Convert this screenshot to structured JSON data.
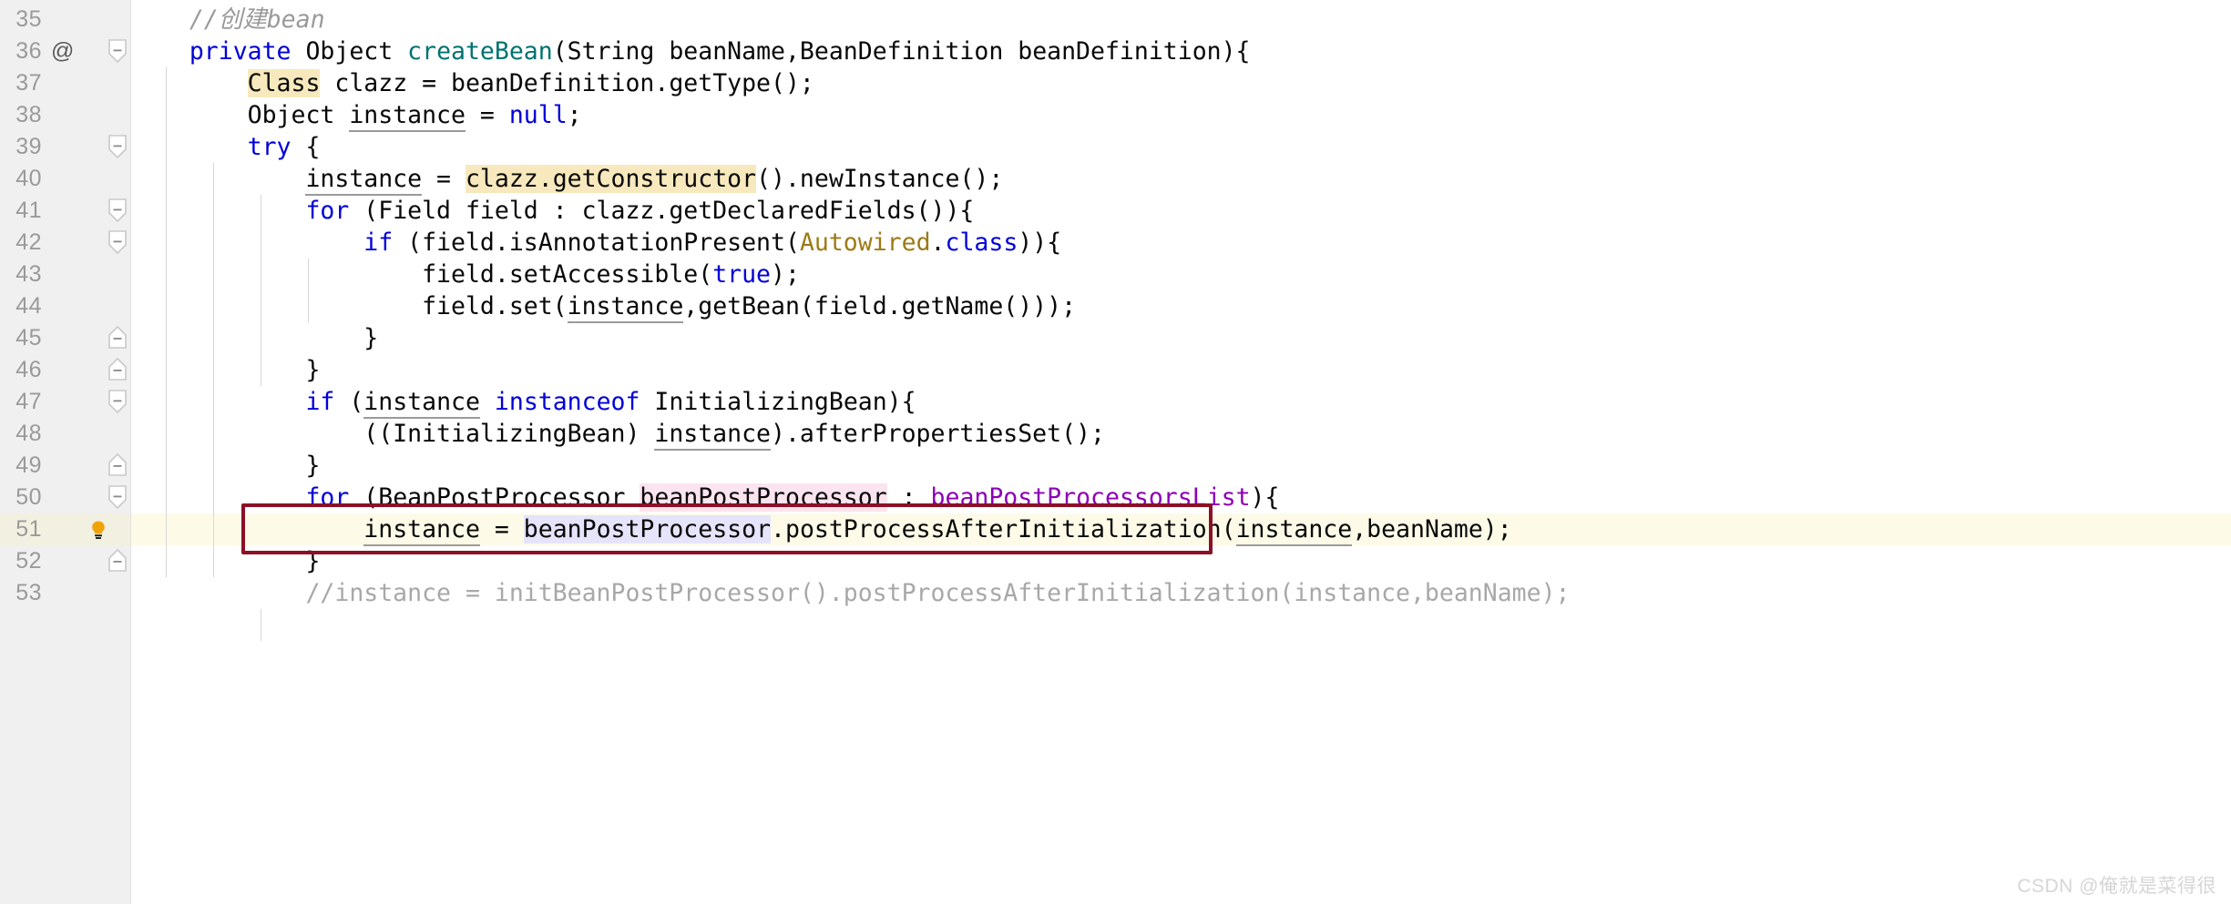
{
  "editor": {
    "first_line": 35,
    "last_line": 53,
    "current_line": 51,
    "gutter_annotation_line": 36,
    "gutter_annotation_symbol": "@",
    "bulb_line": 51,
    "colors": {
      "background": "#ffffff",
      "gutter": "#f0f0f0",
      "line_number": "#9a9a9a",
      "keyword": "#0000d8",
      "method": "#00736f",
      "annotation": "#9c7a15",
      "static_field": "#8d00b5",
      "comment": "#9a9a9a",
      "highlight_yellow": "#f7e9bd",
      "highlight_pink": "#fbe4ef",
      "highlight_violet": "#e6e4fa",
      "current_line_background": "#fdfbe8",
      "error_box_border": "#8c1026"
    }
  },
  "lines": [
    {
      "num": "35",
      "text": "    //创建bean"
    },
    {
      "num": "36",
      "text": "    private Object createBean(String beanName,BeanDefinition beanDefinition){"
    },
    {
      "num": "37",
      "text": "        Class clazz = beanDefinition.getType();"
    },
    {
      "num": "38",
      "text": "        Object instance = null;"
    },
    {
      "num": "39",
      "text": "        try {"
    },
    {
      "num": "40",
      "text": "            instance = clazz.getConstructor().newInstance();"
    },
    {
      "num": "41",
      "text": "            for (Field field : clazz.getDeclaredFields()){"
    },
    {
      "num": "42",
      "text": "                if (field.isAnnotationPresent(Autowired.class)){"
    },
    {
      "num": "43",
      "text": "                    field.setAccessible(true);"
    },
    {
      "num": "44",
      "text": "                    field.set(instance,getBean(field.getName()));"
    },
    {
      "num": "45",
      "text": "                }"
    },
    {
      "num": "46",
      "text": "            }"
    },
    {
      "num": "47",
      "text": "            if (instance instanceof InitializingBean){"
    },
    {
      "num": "48",
      "text": "                ((InitializingBean) instance).afterPropertiesSet();"
    },
    {
      "num": "49",
      "text": "            }"
    },
    {
      "num": "50",
      "text": "            for (BeanPostProcessor beanPostProcessor : beanPostProcessorsList){"
    },
    {
      "num": "51",
      "text": "                instance = beanPostProcessor.postProcessAfterInitialization(instance,beanName);"
    },
    {
      "num": "52",
      "text": "            }"
    },
    {
      "num": "53",
      "text": "            //instance = initBeanPostProcessor().postProcessAfterInitialization(instance,beanName);"
    }
  ],
  "watermark": {
    "text": "CSDN @俺就是菜得很"
  }
}
